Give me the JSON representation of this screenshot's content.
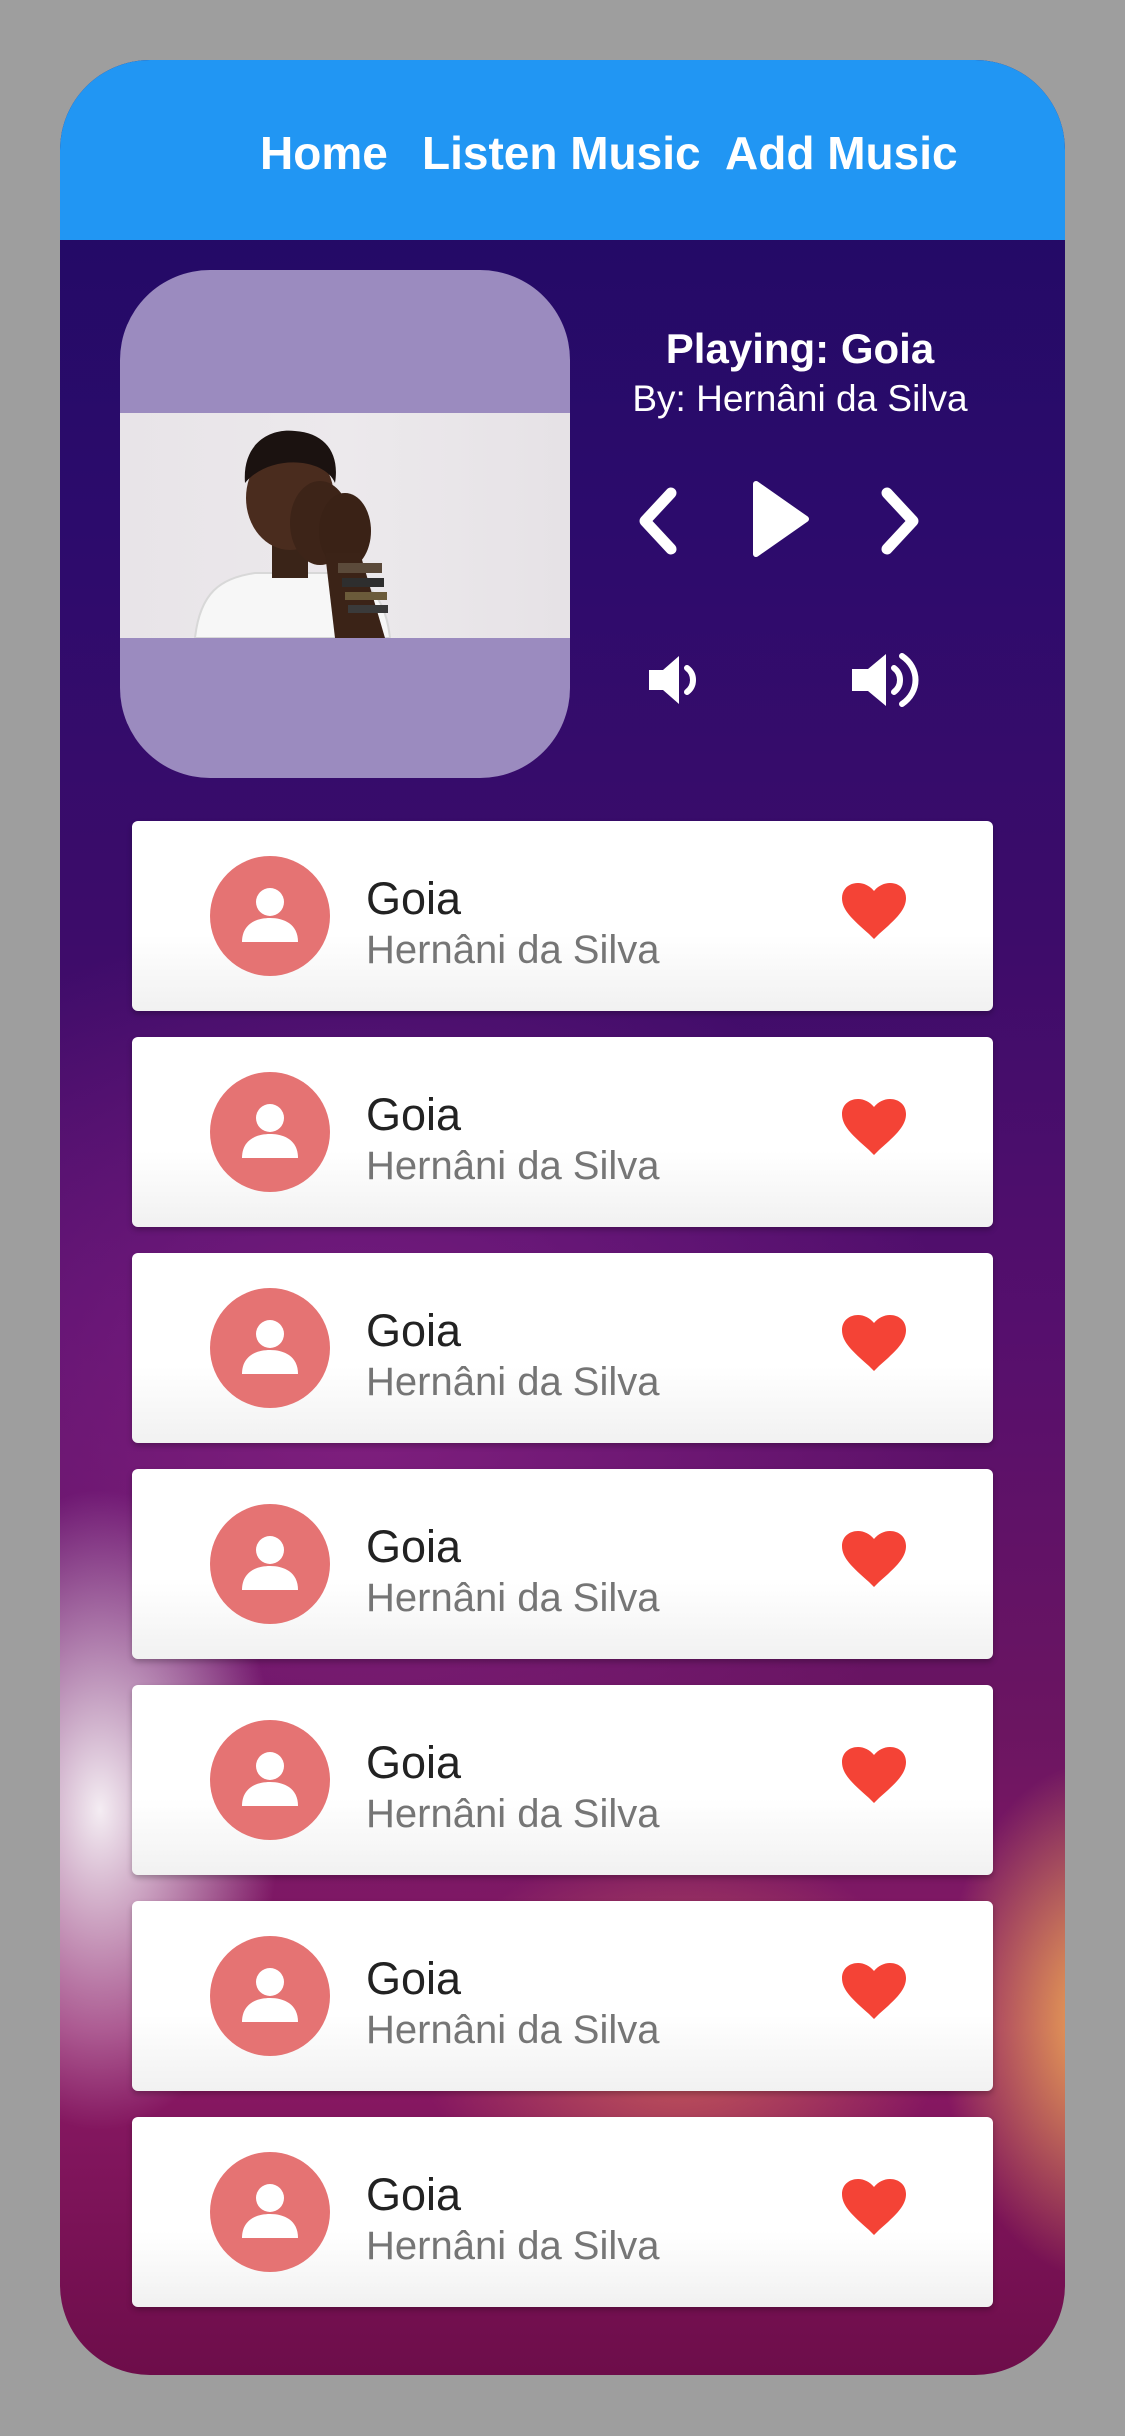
{
  "nav": {
    "items": [
      {
        "label": "Home"
      },
      {
        "label": "Listen Music"
      },
      {
        "label": "Add Music"
      }
    ]
  },
  "now_playing": {
    "title": "Playing: Goia",
    "artist": "By: Hernâni da Silva",
    "controls": [
      "chevron-left-icon",
      "play-icon",
      "chevron-right-icon",
      "volume-down-icon",
      "volume-up-icon"
    ]
  },
  "colors": {
    "appbar": "#2196f3",
    "avatar": "#e57373",
    "heart": "#f44336"
  },
  "songs": [
    {
      "title": "Goia",
      "artist": "Hernâni da Silva"
    },
    {
      "title": "Goia",
      "artist": "Hernâni da Silva"
    },
    {
      "title": "Goia",
      "artist": "Hernâni da Silva"
    },
    {
      "title": "Goia",
      "artist": "Hernâni da Silva"
    },
    {
      "title": "Goia",
      "artist": "Hernâni da Silva"
    },
    {
      "title": "Goia",
      "artist": "Hernâni da Silva"
    },
    {
      "title": "Goia",
      "artist": "Hernâni da Silva"
    }
  ]
}
